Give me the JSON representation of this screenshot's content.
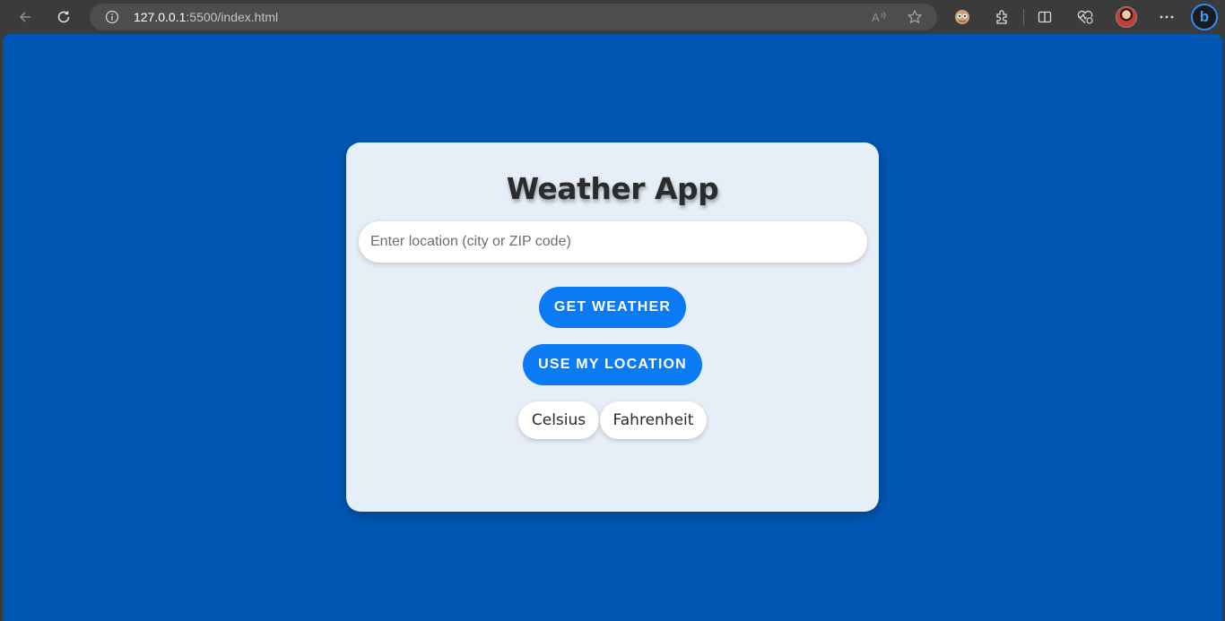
{
  "browser": {
    "url_host": "127.0.0.1",
    "url_rest": ":5500/index.html",
    "icons": [
      "back-arrow-icon",
      "refresh-icon",
      "info-icon",
      "read-aloud-icon",
      "star-icon",
      "extension-icon",
      "puzzle-icon",
      "split-screen-icon",
      "health-icon",
      "profile-avatar",
      "more-icon",
      "bing-icon"
    ]
  },
  "page": {
    "title": "Weather App",
    "location_placeholder": "Enter location (city or ZIP code)",
    "get_weather_label": "GET WEATHER",
    "use_location_label": "USE MY LOCATION",
    "celsius_label": "Celsius",
    "fahrenheit_label": "Fahrenheit"
  },
  "colors": {
    "page_background": "#0057b3",
    "card_background": "#e6eef7",
    "primary_button": "#0a7bf5"
  }
}
